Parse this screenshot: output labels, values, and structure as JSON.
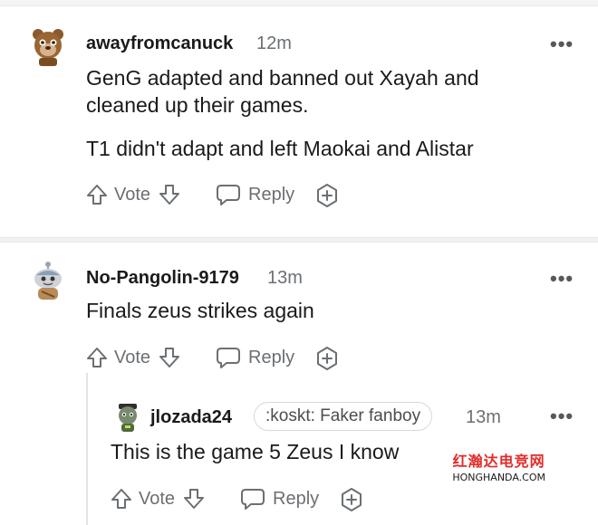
{
  "comments": [
    {
      "username": "awayfromcanuck",
      "time": "12m",
      "paragraphs": [
        "GenG adapted and banned out Xayah and cleaned up their games.",
        "T1 didn't adapt and left Maokai and Alistar"
      ],
      "vote_label": "Vote",
      "reply_label": "Reply",
      "more": "•••"
    },
    {
      "username": "No-Pangolin-9179",
      "time": "13m",
      "paragraphs": [
        "Finals zeus strikes again"
      ],
      "vote_label": "Vote",
      "reply_label": "Reply",
      "more": "•••"
    },
    {
      "username": "jlozada24",
      "flair": ":koskt: Faker fanboy",
      "time": "13m",
      "paragraphs": [
        "This is the game 5 Zeus I know"
      ],
      "vote_label": "Vote",
      "reply_label": "Reply",
      "more": "•••"
    }
  ],
  "watermark": {
    "chinese": "红瀚达电竞网",
    "domain": "HONGHANDA.COM"
  },
  "icons": {
    "upvote": "arrow-up-icon",
    "downvote": "arrow-down-icon",
    "reply": "speech-bubble-icon",
    "award": "plus-award-icon",
    "more": "ellipsis-icon"
  }
}
